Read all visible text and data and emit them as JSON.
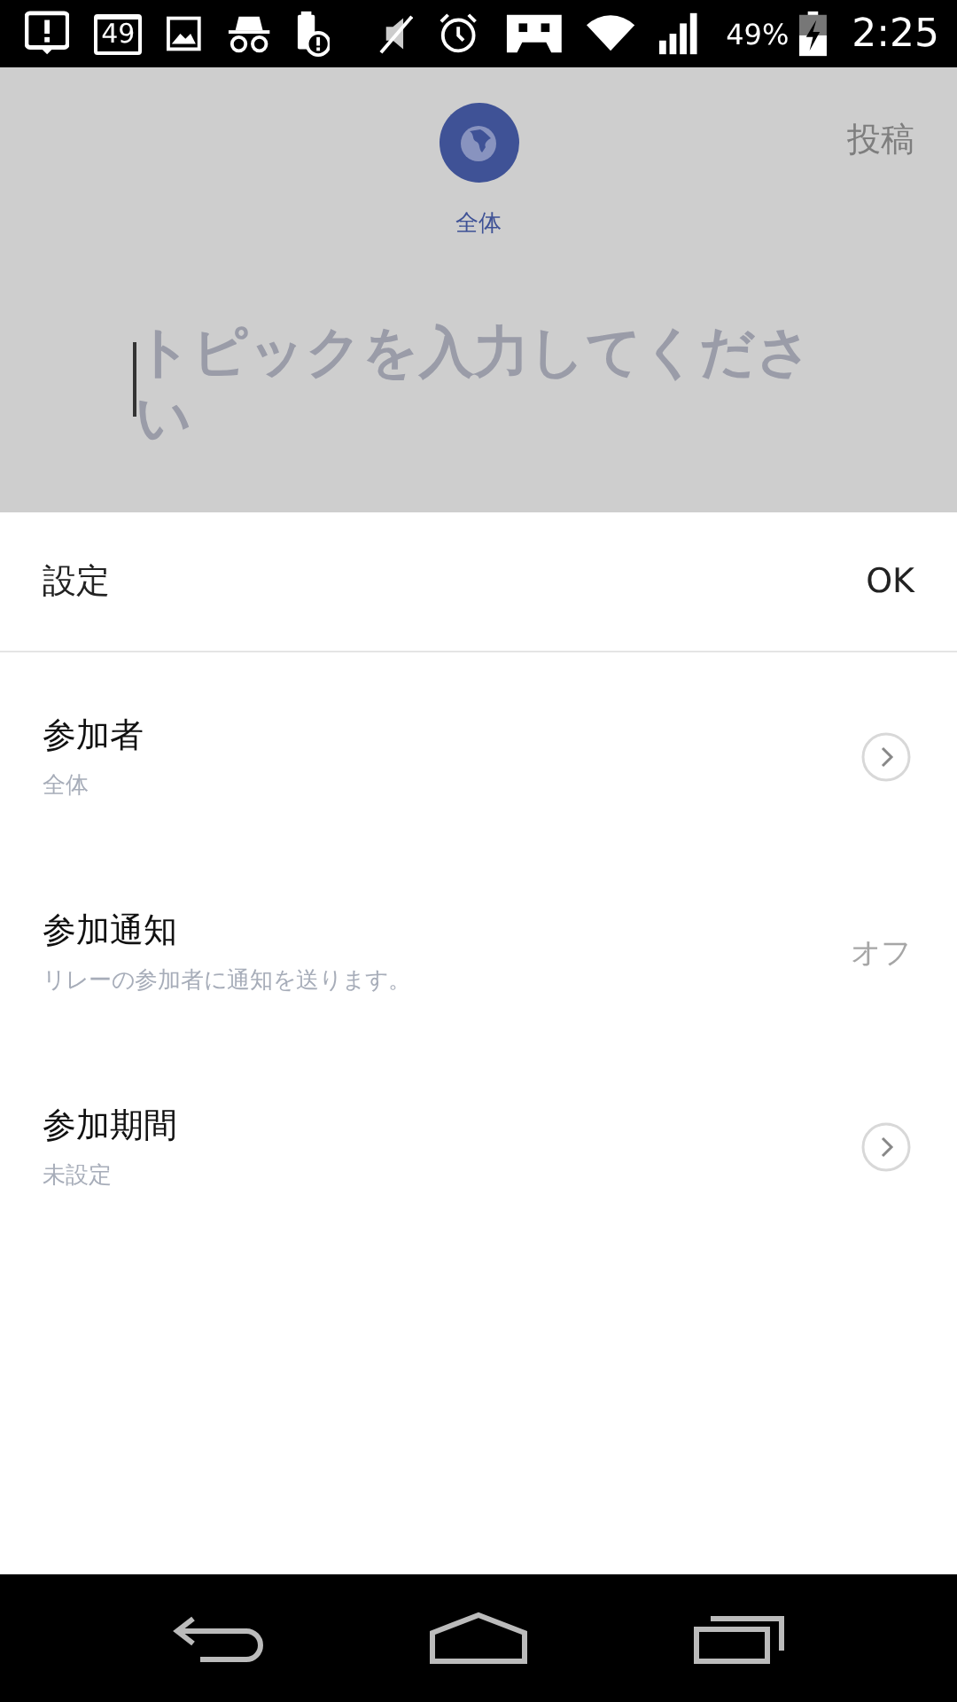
{
  "status_bar": {
    "calendar_badge": "49",
    "battery": "49%",
    "time": "2:25"
  },
  "compose": {
    "audience": "全体",
    "post": "投稿",
    "topic": {
      "placeholder": "トピックを入力してください"
    }
  },
  "settings": {
    "title": "設定",
    "confirm": "OK",
    "rows": [
      {
        "kind": "link",
        "title": "参加者",
        "subtitle": "全体"
      },
      {
        "kind": "value",
        "title": "参加通知",
        "subtitle": "リレーの参加者に通知を送ります。",
        "value": "オフ"
      },
      {
        "kind": "link",
        "title": "参加期間",
        "subtitle": "未設定"
      }
    ]
  }
}
